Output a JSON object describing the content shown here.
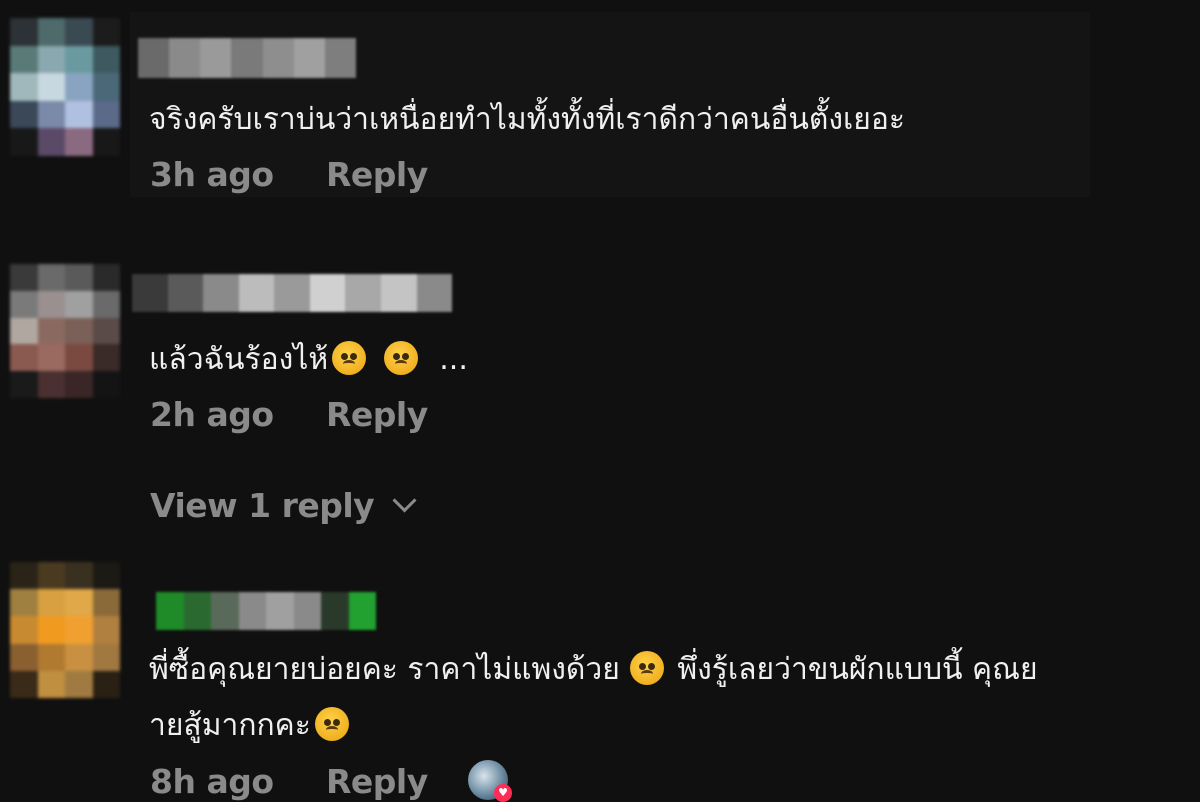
{
  "comments": [
    {
      "text": "จริงครับเราบ่นว่าเหนื่อยทำไมทั้งทั้งที่เราดีกว่าคนอื่นตั้งเยอะ",
      "time": "3h ago",
      "reply_label": "Reply"
    },
    {
      "text_prefix": "แล้วฉันร้องไห้",
      "text_suffix": "...",
      "time": "2h ago",
      "reply_label": "Reply",
      "view_replies_label": "View 1 reply"
    },
    {
      "line1_a": "พี่ซื้อคุณยายบ่อยคะ ราคาไม่แพงด้วย",
      "line1_b": "พึ่งรู้เลยว่าขนผักแบบนี้ คุณย",
      "line2": "ายสู้มากกคะ",
      "time": "8h ago",
      "reply_label": "Reply"
    }
  ],
  "icons": {
    "emoji": "sad-face-emoji",
    "chevron": "chevron-down-icon",
    "liked_by_author": "author-liked-avatar-icon",
    "heart": "heart-icon"
  },
  "colors": {
    "background": "#101010",
    "text": "#f0f0f0",
    "meta": "#8a8a8a",
    "heart": "#ff2d55"
  }
}
